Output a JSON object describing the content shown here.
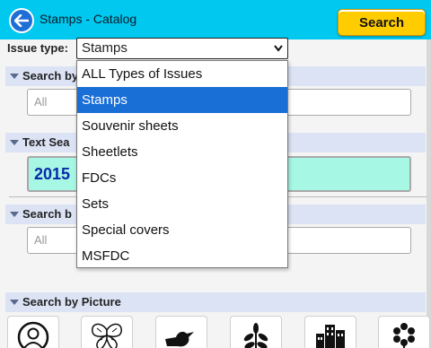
{
  "header": {
    "title": "Stamps - Catalog",
    "search_label": "Search",
    "accent_color": "#00c8ee",
    "search_button_color": "#ffcc00"
  },
  "issue_type": {
    "label": "Issue type:",
    "value": "Stamps",
    "options": [
      "ALL Types of Issues",
      "Stamps",
      "Souvenir sheets",
      "Sheetlets",
      "FDCs",
      "Sets",
      "Special covers",
      "MSFDC"
    ],
    "selected_option": "Stamps"
  },
  "sections": {
    "search_by_1": {
      "label": "Search by",
      "input_value": "All"
    },
    "text_search": {
      "label": "Text Sea",
      "input_value": "2015"
    },
    "search_by_2": {
      "label": "Search b",
      "input_value": "All"
    },
    "search_by_picture": {
      "label": "Search by Picture",
      "tiles": [
        "person-icon",
        "butterfly-icon",
        "bird-icon",
        "plant-icon",
        "buildings-icon",
        "flower-icon"
      ]
    }
  }
}
